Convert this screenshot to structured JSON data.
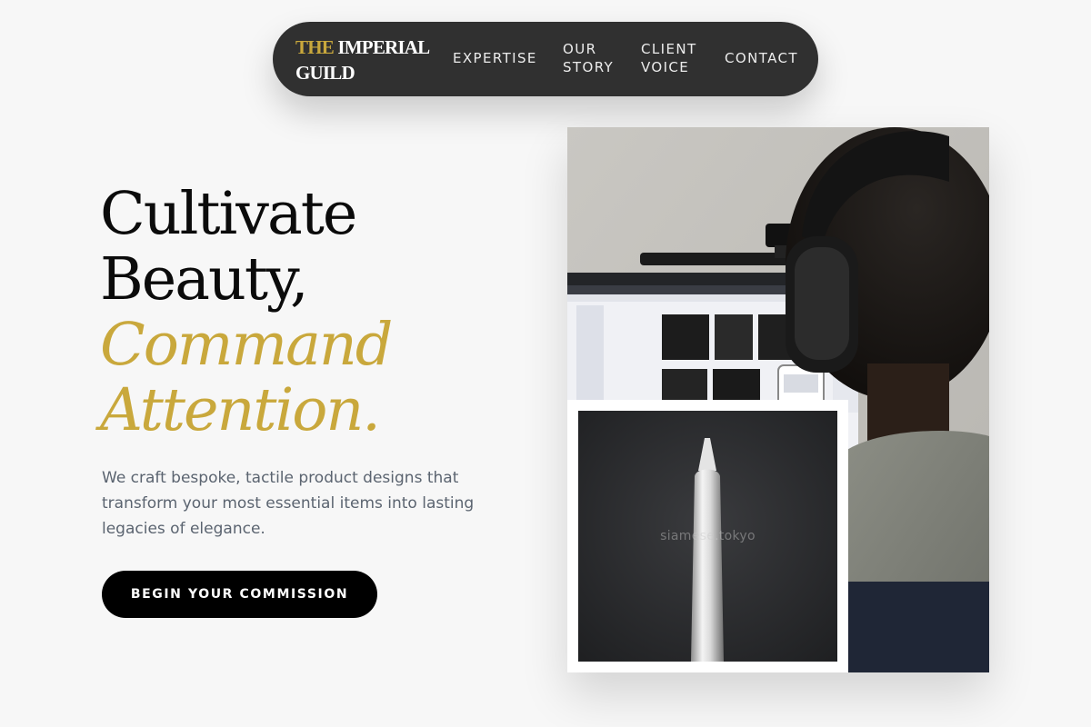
{
  "nav": {
    "brand": {
      "accent": "THE",
      "rest_line1": "IMPERIAL",
      "rest_line2": "GUILD"
    },
    "links": [
      {
        "lines": [
          "EXPERTISE"
        ]
      },
      {
        "lines": [
          "OUR",
          "STORY"
        ]
      },
      {
        "lines": [
          "CLIENT",
          "VOICE"
        ]
      },
      {
        "lines": [
          "CONTACT"
        ]
      }
    ]
  },
  "hero": {
    "headline_line1": "Cultivate",
    "headline_line2": "Beauty,",
    "headline_accent_line1": "Command",
    "headline_accent_line2": "Attention.",
    "subcopy": "We craft bespoke, tactile product designs that transform your most essential items into lasting legacies of elegance.",
    "cta_label": "BEGIN YOUR COMMISSION"
  },
  "images": {
    "inset_watermark": "siamese.tokyo"
  },
  "colors": {
    "accent_gold": "#c9a83c",
    "nav_background": "#303030",
    "page_background": "#f7f7f7",
    "cta_background": "#000000",
    "body_text": "#5b6470"
  }
}
